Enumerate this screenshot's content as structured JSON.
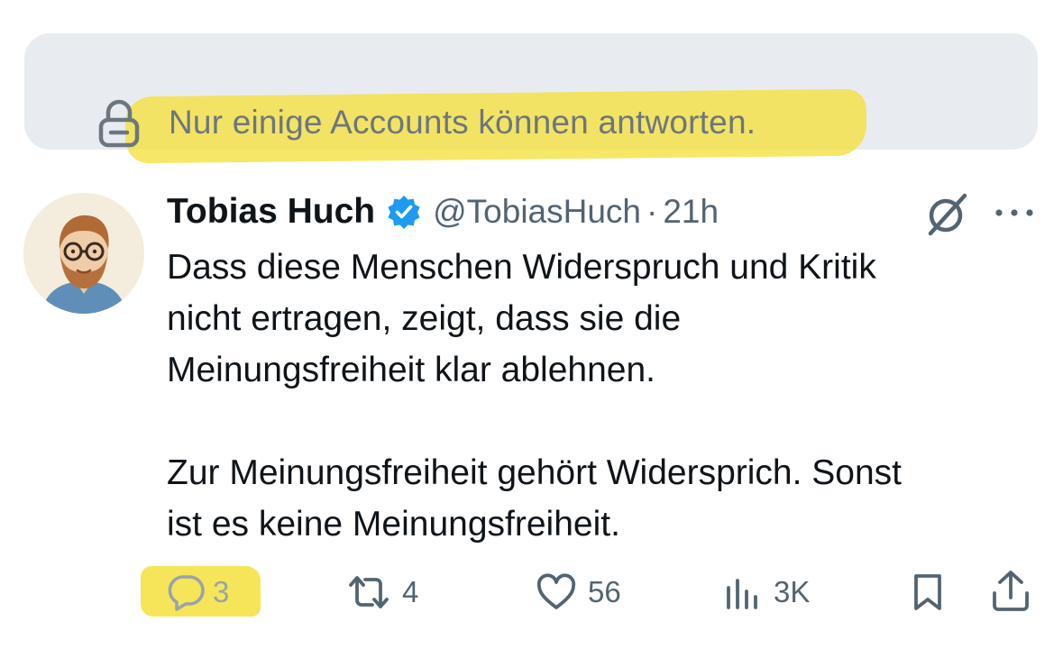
{
  "notice": {
    "text": "Nur einige Accounts können antworten.",
    "icon": "lock-icon"
  },
  "tweet": {
    "author_name": "Tobias Huch",
    "handle": "@TobiasHuch",
    "separator": "·",
    "time": "21h",
    "verified": true,
    "body_lines": [
      "Dass diese Menschen Widerspruch und Kritik",
      "nicht ertragen, zeigt, dass sie die",
      "Meinungsfreiheit klar ablehnen.",
      "Zur Meinungsfreiheit gehört Widersprich. Sonst",
      "ist es keine Meinungsfreiheit."
    ],
    "stats": {
      "replies": "3",
      "retweets": "4",
      "likes": "56",
      "views": "3K"
    }
  },
  "colors": {
    "highlight": "#f5e03c",
    "notice_bg": "#e8ecf1",
    "verified_blue": "#1d9bf0",
    "muted": "#536471",
    "text": "#0f1419"
  }
}
